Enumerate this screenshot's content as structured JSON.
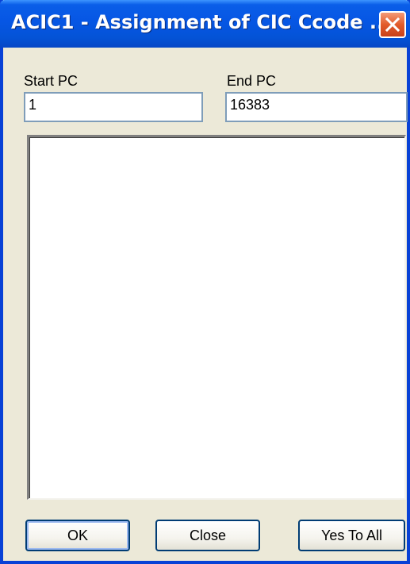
{
  "window": {
    "title": "ACIC1 - Assignment of CIC Ccode ..."
  },
  "start_pc": {
    "label": "Start PC",
    "value": "1"
  },
  "end_pc": {
    "label": "End PC",
    "value": "16383"
  },
  "buttons": {
    "ok": "OK",
    "close": "Close",
    "yes_to_all": "Yes To All"
  },
  "icons": {
    "close": "close-icon"
  },
  "colors": {
    "titlebar": "#0656e4",
    "window_bg": "#ece9d8",
    "close_button": "#e25b2b"
  }
}
